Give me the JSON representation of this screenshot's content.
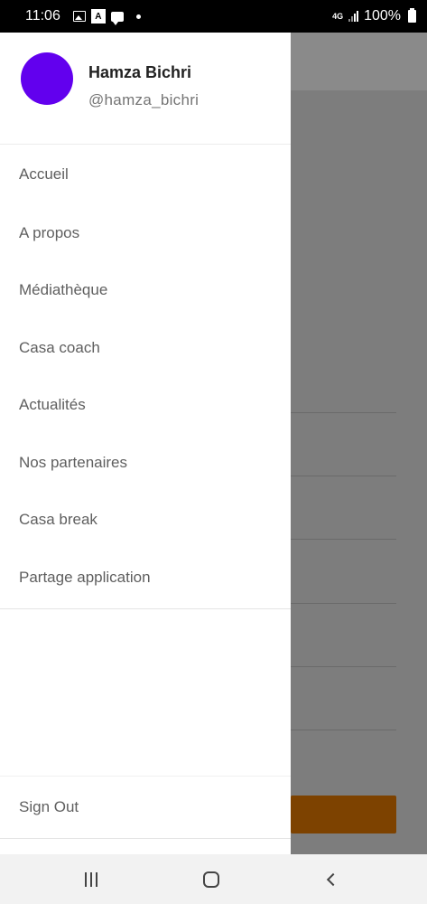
{
  "status_bar": {
    "time": "11:06",
    "network": "4G",
    "battery": "100%",
    "notification_badge": "A"
  },
  "drawer": {
    "user_name": "Hamza Bichri",
    "user_handle": "@hamza_bichri",
    "avatar_color": "#6200ee",
    "menu": [
      {
        "label": "Accueil"
      },
      {
        "label": "A propos"
      },
      {
        "label": "Médiathèque"
      },
      {
        "label": "Casa coach"
      },
      {
        "label": "Actualités"
      },
      {
        "label": "Nos partenaires"
      },
      {
        "label": "Casa break"
      },
      {
        "label": "Partage application"
      }
    ],
    "sign_out": "Sign Out"
  },
  "colors": {
    "accent_button": "#7d4200",
    "scrim": "#7d7d7d"
  },
  "nav_bar": {
    "icons": [
      "recents-icon",
      "home-icon",
      "back-icon"
    ]
  }
}
